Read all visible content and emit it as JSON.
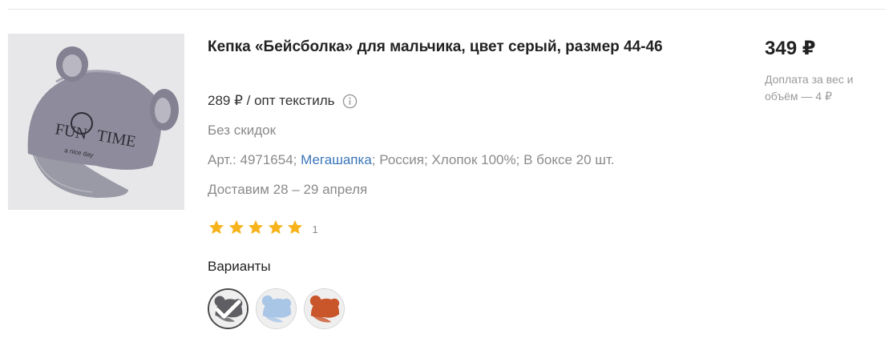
{
  "product": {
    "title": "Кепка «Бейсболка» для мальчика, цвет серый, размер 44-46",
    "image_alt": "Кепка FUN TIME",
    "opt_price": "289 ₽ / опт текстиль",
    "discount_text": "Без скидок",
    "meta": {
      "prefix": "Арт.: 4971654; ",
      "brand": "Мегашапка",
      "suffix": "; Россия; Хлопок 100%; В боксе 20 шт."
    },
    "delivery": "Доставим 28 – 29 апреля",
    "rating": {
      "stars": 5,
      "max_stars": 5,
      "count": "1"
    },
    "variants_label": "Варианты",
    "variants": [
      {
        "color_name": "серый",
        "color": "#5f5f63",
        "selected": true
      },
      {
        "color_name": "голубой",
        "color": "#a9c6e6",
        "selected": false
      },
      {
        "color_name": "оранжевый",
        "color": "#c9562a",
        "selected": false
      }
    ],
    "price": "349 ₽",
    "price_note": "Доплата за вес и объём — 4 ₽"
  },
  "colors": {
    "star": "#f7b31c",
    "link": "#3a76b8",
    "muted": "#8a8a8a"
  },
  "icons": {
    "info": "info-icon",
    "star": "star-icon",
    "check": "check-icon"
  }
}
